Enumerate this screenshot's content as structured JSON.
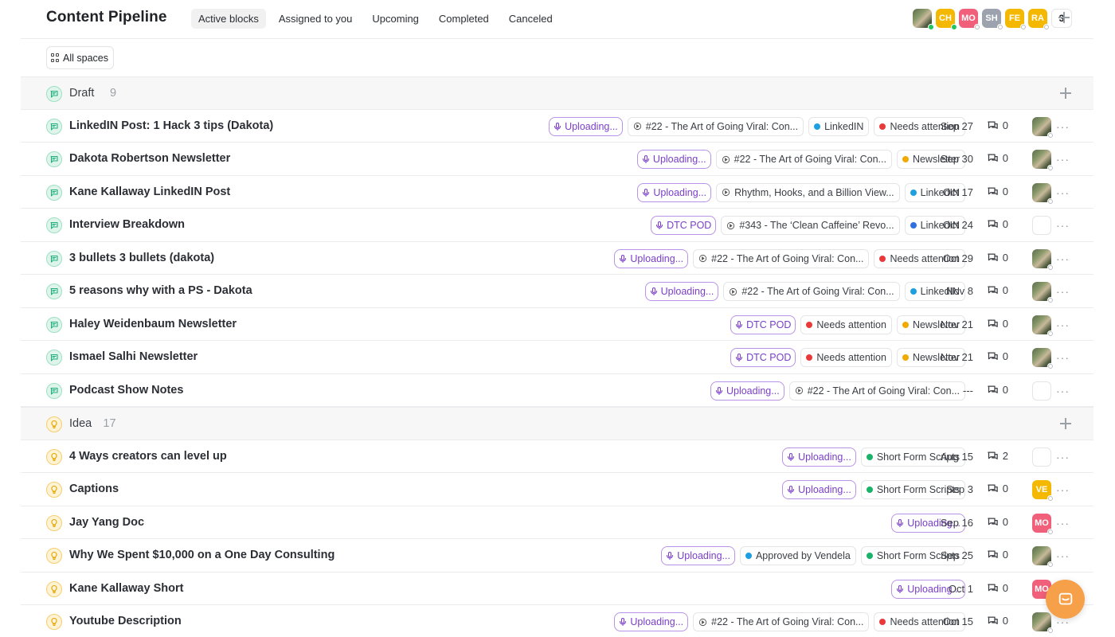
{
  "header": {
    "title": "Content Pipeline",
    "tabs": [
      {
        "label": "Active blocks",
        "active": true
      },
      {
        "label": "Assigned to you",
        "active": false
      },
      {
        "label": "Upcoming",
        "active": false
      },
      {
        "label": "Completed",
        "active": false
      },
      {
        "label": "Canceled",
        "active": false
      }
    ],
    "members": [
      {
        "initials": "",
        "color": "photo",
        "online": true
      },
      {
        "initials": "CH",
        "color": "#f5b800",
        "online": true
      },
      {
        "initials": "MO",
        "color": "#f0607a",
        "online": false
      },
      {
        "initials": "SH",
        "color": "#9ca3af",
        "online": false
      },
      {
        "initials": "FE",
        "color": "#f5b800",
        "online": false
      },
      {
        "initials": "RA",
        "color": "#f5b800",
        "online": false
      }
    ],
    "members_more": "3"
  },
  "filter": {
    "label": "All spaces"
  },
  "colors": {
    "linkedin": "#1ea0e0",
    "newsletter": "#f2a900",
    "attention": "#e83a3a",
    "short_form": "#1bb36a",
    "approved": "#1ea0e0",
    "mic_border": "#b993e6",
    "fab": "#f6a04a"
  },
  "groups": [
    {
      "label": "Draft",
      "count": "9",
      "icon": "chat-bubble-icon",
      "kind": "draft",
      "items": [
        {
          "title": "LinkedIN Post: 1 Hack 3 tips (Dakota)",
          "chips": [
            {
              "type": "mic",
              "text": "Uploading..."
            },
            {
              "type": "episode",
              "text": "#22 - The Art of Going Viral: Con..."
            },
            {
              "type": "dot",
              "color": "#1ea0e0",
              "text": "LinkedIN"
            },
            {
              "type": "dot",
              "color": "#e83a3a",
              "text": "Needs attention"
            }
          ],
          "date": "Sep 27",
          "comments": "0",
          "assignee": {
            "type": "photo"
          }
        },
        {
          "title": "Dakota Robertson Newsletter",
          "chips": [
            {
              "type": "mic",
              "text": "Uploading..."
            },
            {
              "type": "episode",
              "text": "#22 - The Art of Going Viral: Con..."
            },
            {
              "type": "dot",
              "color": "#f2a900",
              "text": "Newsletter"
            }
          ],
          "date": "Sep 30",
          "comments": "0",
          "assignee": {
            "type": "photo"
          }
        },
        {
          "title": "Kane Kallaway LinkedIN Post",
          "chips": [
            {
              "type": "mic",
              "text": "Uploading..."
            },
            {
              "type": "episode",
              "text": "Rhythm, Hooks, and a Billion View..."
            },
            {
              "type": "dot",
              "color": "#1ea0e0",
              "text": "LinkedIN"
            }
          ],
          "date": "Oct 17",
          "comments": "0",
          "assignee": {
            "type": "photo"
          }
        },
        {
          "title": "Interview Breakdown",
          "chips": [
            {
              "type": "mic",
              "text": "DTC POD"
            },
            {
              "type": "episode",
              "text": "#343 - The ‘Clean Caffeine’ Revo..."
            },
            {
              "type": "dot",
              "color": "#2f6fe0",
              "text": "LinkedIN"
            }
          ],
          "date": "Oct 24",
          "comments": "0",
          "assignee": {
            "type": "empty"
          }
        },
        {
          "title": "3 bullets 3 bullets (dakota)",
          "chips": [
            {
              "type": "mic",
              "text": "Uploading..."
            },
            {
              "type": "episode",
              "text": "#22 - The Art of Going Viral: Con..."
            },
            {
              "type": "dot",
              "color": "#e83a3a",
              "text": "Needs attention"
            }
          ],
          "date": "Oct 29",
          "comments": "0",
          "assignee": {
            "type": "photo"
          }
        },
        {
          "title": "5 reasons why with a PS - Dakota",
          "chips": [
            {
              "type": "mic",
              "text": "Uploading..."
            },
            {
              "type": "episode",
              "text": "#22 - The Art of Going Viral: Con..."
            },
            {
              "type": "dot",
              "color": "#1ea0e0",
              "text": "LinkedIN"
            }
          ],
          "date": "Nov 8",
          "comments": "0",
          "assignee": {
            "type": "photo"
          }
        },
        {
          "title": "Haley Weidenbaum Newsletter",
          "chips": [
            {
              "type": "mic",
              "text": "DTC POD"
            },
            {
              "type": "dot",
              "color": "#e83a3a",
              "text": "Needs attention"
            },
            {
              "type": "dot",
              "color": "#f2a900",
              "text": "Newsletter"
            }
          ],
          "date": "Nov 21",
          "comments": "0",
          "assignee": {
            "type": "photo"
          }
        },
        {
          "title": "Ismael Salhi Newsletter",
          "chips": [
            {
              "type": "mic",
              "text": "DTC POD"
            },
            {
              "type": "dot",
              "color": "#e83a3a",
              "text": "Needs attention"
            },
            {
              "type": "dot",
              "color": "#f2a900",
              "text": "Newsletter"
            }
          ],
          "date": "Nov 21",
          "comments": "0",
          "assignee": {
            "type": "photo"
          }
        },
        {
          "title": "Podcast Show Notes",
          "chips": [
            {
              "type": "mic",
              "text": "Uploading..."
            },
            {
              "type": "episode",
              "text": "#22 - The Art of Going Viral: Con..."
            }
          ],
          "date": "---",
          "comments": "0",
          "assignee": {
            "type": "empty"
          }
        }
      ]
    },
    {
      "label": "Idea",
      "count": "17",
      "icon": "lightbulb-icon",
      "kind": "idea",
      "items": [
        {
          "title": "4 Ways creators can level up",
          "chips": [
            {
              "type": "mic",
              "text": "Uploading..."
            },
            {
              "type": "dot",
              "color": "#1bb36a",
              "text": "Short Form Scripts"
            }
          ],
          "date": "Aug 15",
          "comments": "2",
          "assignee": {
            "type": "empty"
          }
        },
        {
          "title": "Captions",
          "chips": [
            {
              "type": "mic",
              "text": "Uploading..."
            },
            {
              "type": "dot",
              "color": "#1bb36a",
              "text": "Short Form Scripts"
            }
          ],
          "date": "Sep 3",
          "comments": "0",
          "assignee": {
            "type": "initials",
            "initials": "VE",
            "color": "#f5b800"
          }
        },
        {
          "title": "Jay Yang Doc",
          "chips": [
            {
              "type": "mic",
              "text": "Uploading..."
            }
          ],
          "date": "Sep 16",
          "comments": "0",
          "assignee": {
            "type": "initials",
            "initials": "MO",
            "color": "#f0607a"
          }
        },
        {
          "title": "Why We Spent $10,000 on a One Day Consulting",
          "chips": [
            {
              "type": "mic",
              "text": "Uploading..."
            },
            {
              "type": "dot",
              "color": "#1ea0e0",
              "text": "Approved by Vendela"
            },
            {
              "type": "dot",
              "color": "#1bb36a",
              "text": "Short Form Scripts"
            }
          ],
          "date": "Sep 25",
          "comments": "0",
          "assignee": {
            "type": "photo"
          }
        },
        {
          "title": "Kane Kallaway Short",
          "chips": [
            {
              "type": "mic",
              "text": "Uploading..."
            }
          ],
          "date": "Oct 1",
          "comments": "0",
          "assignee": {
            "type": "initials",
            "initials": "MO",
            "color": "#f0607a"
          }
        },
        {
          "title": "Youtube Description",
          "chips": [
            {
              "type": "mic",
              "text": "Uploading..."
            },
            {
              "type": "episode",
              "text": "#22 - The Art of Going Viral: Con..."
            },
            {
              "type": "dot",
              "color": "#e83a3a",
              "text": "Needs attention"
            }
          ],
          "date": "Oct 15",
          "comments": "0",
          "assignee": {
            "type": "photo"
          }
        }
      ]
    }
  ]
}
